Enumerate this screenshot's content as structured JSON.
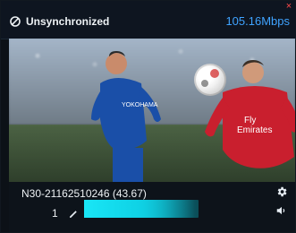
{
  "header": {
    "status_label": "Unsynchronized",
    "bitrate": "105.16Mbps",
    "close_glyph": "×"
  },
  "video": {
    "ball_icon": "soccer-ball",
    "sponsor_text": "Fly Emirates"
  },
  "controls": {
    "stream_id": "N30-21162510246 (43.67)",
    "quality_value": "1",
    "progress_fraction": 0.97
  },
  "icons": {
    "sync_icon": "block-circle-icon",
    "settings_icon": "gear-icon",
    "edit_icon": "pencil-icon",
    "volume_icon": "speaker-icon"
  },
  "colors": {
    "accent": "#3fa3ff",
    "bar": "#0bd3e6",
    "close": "#ff4b4b"
  }
}
